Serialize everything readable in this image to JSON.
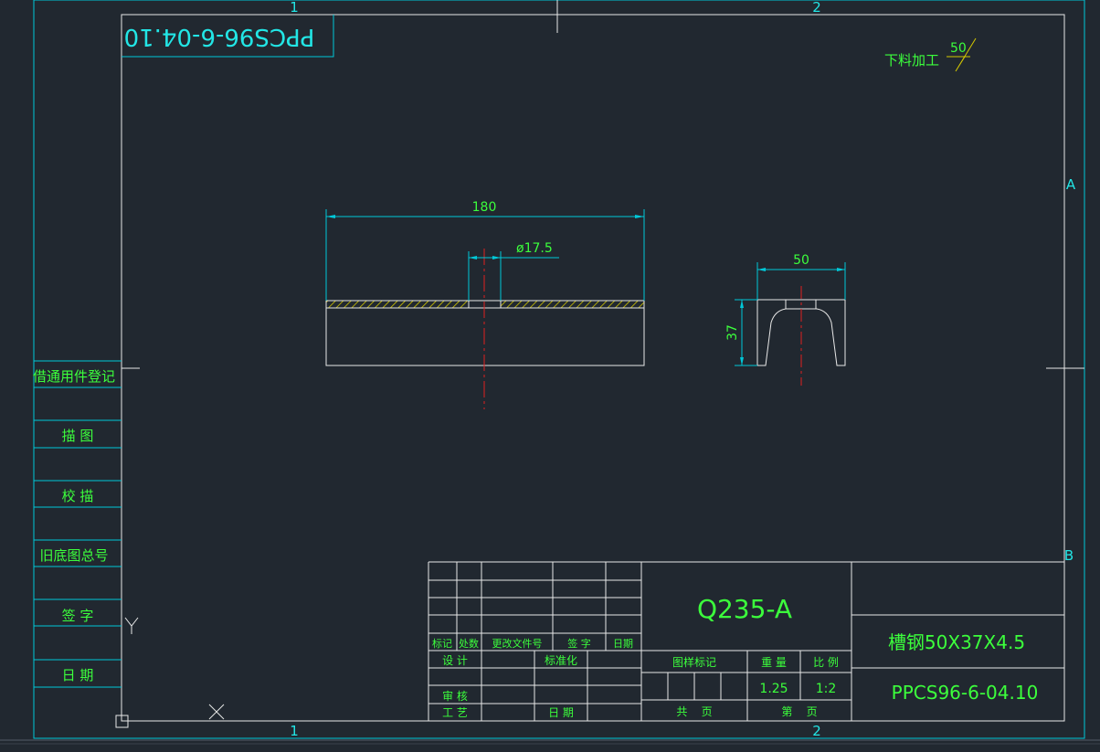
{
  "grid": {
    "top_cols": [
      "1",
      "2"
    ],
    "bottom_cols": [
      "1",
      "2"
    ],
    "rows": [
      "A",
      "B"
    ]
  },
  "mirrored_code": "PPCS96-6-04.10",
  "surface_finish": {
    "label": "下料加工",
    "value": "50"
  },
  "front_view": {
    "length": "180",
    "hole": "ø17.5"
  },
  "side_view": {
    "width": "50",
    "height": "37"
  },
  "left_panel": [
    "借通用件登记",
    "描 图",
    "校 描",
    "旧底图总号",
    "签 字",
    "日 期"
  ],
  "title_block": {
    "rev_headers": [
      "标记",
      "处数",
      "更改文件号",
      "签 字",
      "日期"
    ],
    "design": "设 计",
    "standardize": "标准化",
    "review": "审 核",
    "process": "工 艺",
    "date": "日 期",
    "material": "Q235-A",
    "stage_mark": "图样标记",
    "weight_label": "重 量",
    "scale_label": "比 例",
    "weight": "1.25",
    "scale": "1:2",
    "total_label": "共    页",
    "sheet_label": "第    页",
    "part_name": "槽钢50X37X4.5",
    "drawing_no": "PPCS96-6-04.10"
  },
  "colors": {
    "frame": "#00c8d8",
    "geometry": "#e8e8e8",
    "text": "#3cff3c",
    "centerline": "#e02020",
    "hatch": "#d4c800",
    "background": "#212830"
  }
}
